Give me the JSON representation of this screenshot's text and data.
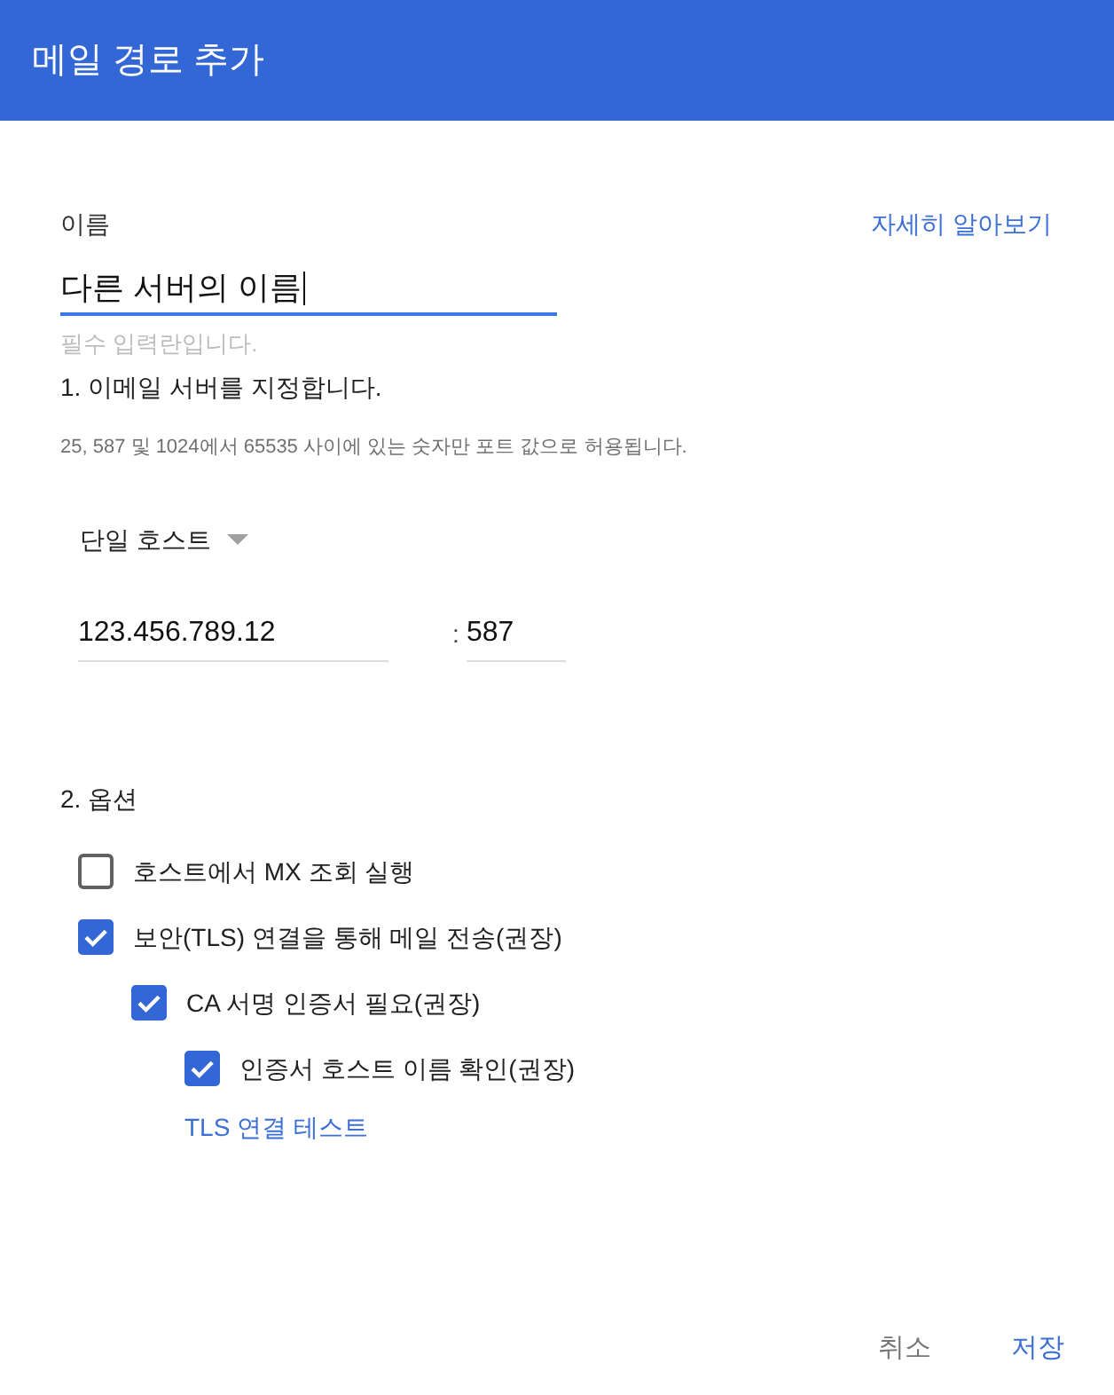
{
  "header": {
    "title": "메일 경로 추가"
  },
  "name_field": {
    "label": "이름",
    "help_link": "자세히 알아보기",
    "value": "다른 서버의 이름",
    "focused": true,
    "helper": "필수 입력란입니다."
  },
  "server": {
    "title": "1. 이메일 서버를 지정합니다.",
    "hint": "25, 587 및 1024에서 65535 사이에 있는 숫자만 포트 값으로 허용됩니다.",
    "host_type": "단일 호스트",
    "host": "123.456.789.12",
    "port_separator": ":",
    "port": "587"
  },
  "options": {
    "title": "2. 옵션",
    "checkboxes": [
      {
        "label": "호스트에서 MX 조회 실행",
        "checked": false
      },
      {
        "label": "보안(TLS) 연결을 통해 메일 전송(권장)",
        "checked": true,
        "children": [
          {
            "label": "CA 서명 인증서 필요(권장)",
            "checked": true,
            "children": [
              {
                "label": "인증서 호스트 이름 확인(권장)",
                "checked": true
              }
            ]
          }
        ]
      }
    ],
    "test_link": "TLS 연결 테스트"
  },
  "buttons": [
    {
      "label": "취소",
      "kind": "cancel"
    },
    {
      "label": "저장",
      "kind": "primary"
    }
  ]
}
